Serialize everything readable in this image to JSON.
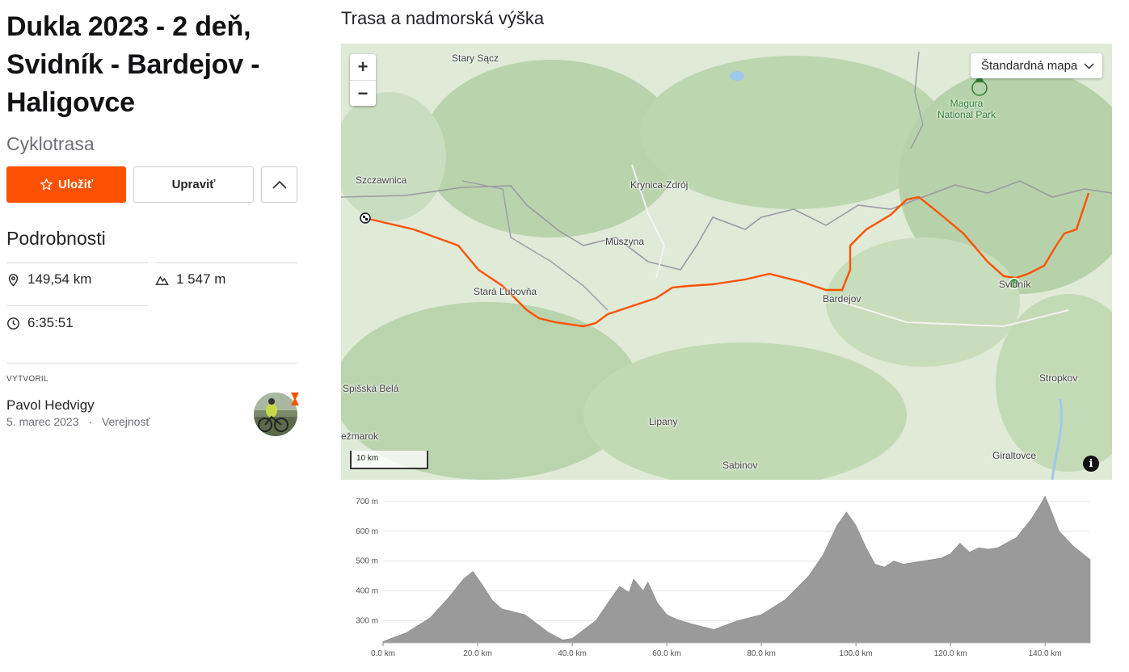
{
  "route": {
    "title": "Dukla 2023 - 2 deň, Svidník - Bardejov - Haligovce",
    "type": "Cyklotrasa"
  },
  "actions": {
    "save_label": "Uložiť",
    "edit_label": "Upraviť"
  },
  "details": {
    "heading": "Podrobnosti",
    "distance": "149,54 km",
    "elevation_gain": "1 547 m",
    "time": "6:35:51"
  },
  "creator": {
    "label": "VYTVORIL",
    "name": "Pavol Hedvigy",
    "date": "5. marec 2023",
    "separator": "·",
    "visibility": "Verejnosť"
  },
  "map_section": {
    "title": "Trasa a nadmorská výška",
    "map_type": "Štandardná mapa",
    "zoom_in": "+",
    "zoom_out": "−",
    "scale": "10 km",
    "info": "i",
    "park_line1": "Magura",
    "park_line2": "National Park",
    "places": [
      {
        "name": "Stary Sącz"
      },
      {
        "name": "Szczawnica"
      },
      {
        "name": "Krynica-Zdrój"
      },
      {
        "name": "Muszyna"
      },
      {
        "name": "Stará Ľubovňa"
      },
      {
        "name": "Bardejov"
      },
      {
        "name": "Svidník"
      },
      {
        "name": "Stropkov"
      },
      {
        "name": "Spišská Belá"
      },
      {
        "name": "Lipany"
      },
      {
        "name": "ežmarok"
      },
      {
        "name": "Sabinov"
      },
      {
        "name": "Giraltovce"
      }
    ]
  },
  "colors": {
    "accent": "#fc5200",
    "route": "#fc5200",
    "start_marker": "#1e8a1e",
    "elevation_fill": "#9a9a9a"
  },
  "chart_data": {
    "type": "area",
    "title": "",
    "xlabel": "",
    "ylabel": "",
    "x_ticks": [
      "0.0 km",
      "20.0 km",
      "40.0 km",
      "60.0 km",
      "80.0 km",
      "100.0 km",
      "120.0 km",
      "140.0 km"
    ],
    "y_ticks": [
      "300 m",
      "400 m",
      "500 m",
      "600 m",
      "700 m"
    ],
    "xlim": [
      0,
      149.54
    ],
    "ylim": [
      225,
      730
    ],
    "series": [
      {
        "x": [
          0,
          5,
          10,
          14,
          17,
          19,
          21,
          23,
          25,
          30,
          35,
          38,
          40,
          45,
          48,
          50,
          52,
          53,
          55,
          56,
          58,
          60,
          62,
          65,
          70,
          75,
          80,
          85,
          90,
          93,
          96,
          98,
          100,
          102,
          104,
          106,
          108,
          110,
          114,
          118,
          120,
          122,
          124,
          126,
          128,
          130,
          134,
          137,
          139,
          140,
          141,
          143,
          146,
          149.54
        ],
        "y": [
          230,
          260,
          310,
          380,
          440,
          465,
          420,
          370,
          340,
          320,
          260,
          235,
          240,
          300,
          370,
          415,
          395,
          440,
          400,
          430,
          360,
          320,
          305,
          290,
          270,
          300,
          320,
          370,
          450,
          520,
          620,
          665,
          620,
          550,
          490,
          480,
          500,
          490,
          500,
          510,
          525,
          560,
          530,
          545,
          540,
          545,
          580,
          640,
          690,
          718,
          680,
          600,
          550,
          505
        ]
      }
    ]
  }
}
